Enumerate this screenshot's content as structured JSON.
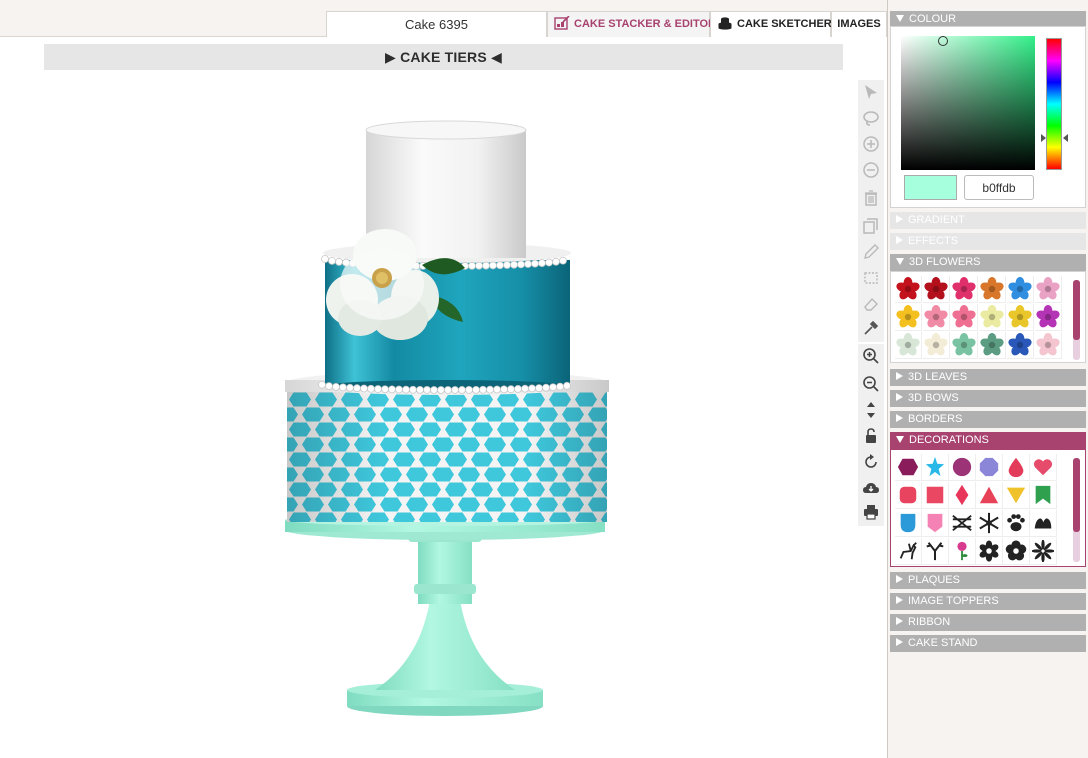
{
  "top_bar": {
    "cake_name": "Cake 6395",
    "tabs": [
      {
        "label": "CAKE STACKER & EDITOR",
        "active": true
      },
      {
        "label": "CAKE SKETCHER",
        "active": false
      },
      {
        "label": "IMAGES",
        "active": false
      }
    ]
  },
  "tiers_bar": {
    "label": "CAKE TIERS"
  },
  "toolbar": {
    "tools": [
      "select-arrow-icon",
      "lasso-icon",
      "zoom-in-circle-icon",
      "zoom-out-circle-icon",
      "trash-icon",
      "duplicate-icon",
      "pencil-icon",
      "crop-icon",
      "eraser-icon",
      "eyedropper-icon",
      "magnify-plus-icon",
      "magnify-minus-icon",
      "move-vertical-icon",
      "unlock-icon",
      "rotate-icon",
      "cloud-download-icon",
      "print-icon"
    ]
  },
  "right_panel": {
    "colour": {
      "label": "COLOUR",
      "hex_value": "b0ffdb",
      "swatch_color": "#a6ffdd",
      "hue_color": "#33f08a"
    },
    "sections": {
      "gradient": "GRADIENT",
      "effects": "EFFECTS",
      "flowers": "3D FLOWERS",
      "leaves": "3D LEAVES",
      "bows": "3D BOWS",
      "borders": "BORDERS",
      "decorations": "DECORATIONS",
      "plaques": "PLAQUES",
      "image_toppers": "IMAGE TOPPERS",
      "ribbon": "RIBBON",
      "cake_stand": "CAKE STAND"
    },
    "flowers": [
      "#c4121d",
      "#b3101c",
      "#e0306b",
      "#d8772b",
      "#2f8ee0",
      "#e9a2c4",
      "#f3c020",
      "#f08aa5",
      "#ee6f92",
      "#eaeaa0",
      "#e9c72a",
      "#b534b6",
      "#d7e6d7",
      "#f3ecd6",
      "#7ac3a2",
      "#5c9c83",
      "#2a58b8",
      "#f4c5cf"
    ],
    "decorations": [
      {
        "shape": "hexagon",
        "color": "#8a1c5c"
      },
      {
        "shape": "star",
        "color": "#28b8e8"
      },
      {
        "shape": "circle",
        "color": "#9c3376"
      },
      {
        "shape": "octagon",
        "color": "#8c86d8"
      },
      {
        "shape": "drop",
        "color": "#e33b5a"
      },
      {
        "shape": "heart",
        "color": "#e64b6b"
      },
      {
        "shape": "rounded-square",
        "color": "#e8445f"
      },
      {
        "shape": "square",
        "color": "#e94762"
      },
      {
        "shape": "diamond",
        "color": "#e8355a"
      },
      {
        "shape": "triangle",
        "color": "#e84258"
      },
      {
        "shape": "triangle-down",
        "color": "#f0c22a"
      },
      {
        "shape": "banner",
        "color": "#2ea04e"
      },
      {
        "shape": "shield",
        "color": "#2c9ad8"
      },
      {
        "shape": "pennant",
        "color": "#f482b4"
      },
      {
        "shape": "crossed-lines",
        "color": "#222222"
      },
      {
        "shape": "snowflake",
        "color": "#222222"
      },
      {
        "shape": "paw",
        "color": "#222222"
      },
      {
        "shape": "bells",
        "color": "#222222"
      },
      {
        "shape": "reindeer",
        "color": "#222222"
      },
      {
        "shape": "antlers",
        "color": "#222222"
      },
      {
        "shape": "rose",
        "color": "#d83a8e"
      },
      {
        "shape": "flower",
        "color": "#222222"
      },
      {
        "shape": "flower-round",
        "color": "#222222"
      },
      {
        "shape": "starburst",
        "color": "#222222"
      }
    ]
  }
}
